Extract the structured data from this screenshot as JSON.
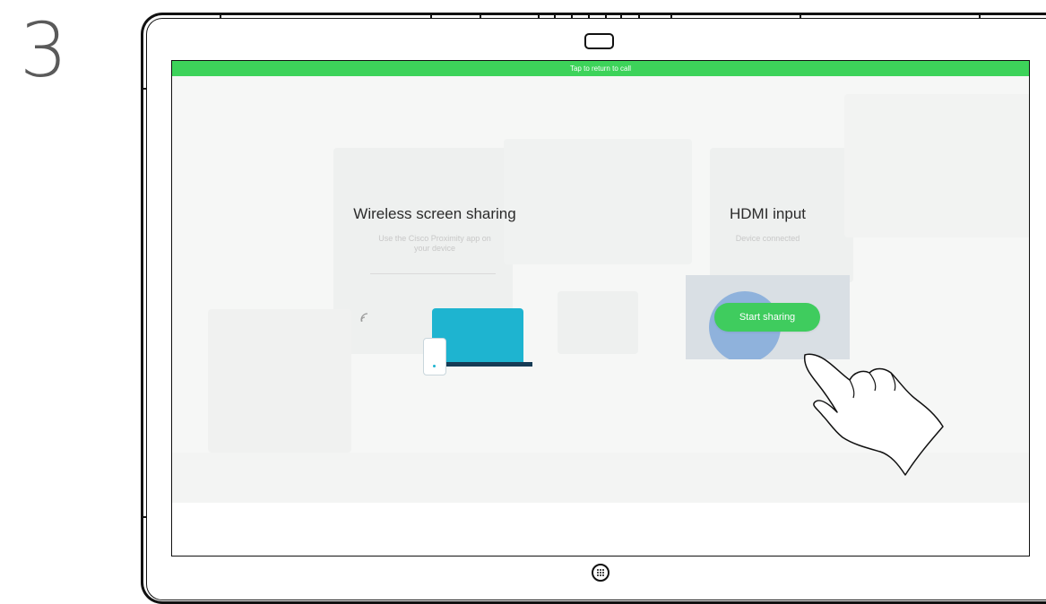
{
  "step": {
    "number": "3"
  },
  "header": {
    "return_bar_label": "Tap to return to call"
  },
  "wireless": {
    "title": "Wireless screen sharing",
    "subtitle_line1": "Use the Cisco Proximity app on",
    "subtitle_line2": "your device",
    "icon": "wireless-signal-icon"
  },
  "hdmi": {
    "title": "HDMI input",
    "status": "Device connected",
    "start_button_label": "Start sharing"
  },
  "colors": {
    "accent_green": "#3dd35a",
    "button_green": "#3fcc5e",
    "laptop_blue": "#1eb4d0",
    "laptop_base": "#163b55"
  },
  "icons": {
    "home": "home-button-icon",
    "camera": "camera-icon",
    "hand": "tapping-hand-icon"
  }
}
